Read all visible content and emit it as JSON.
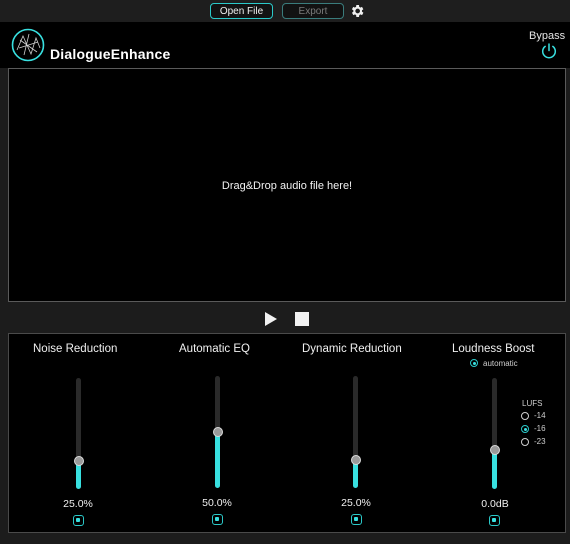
{
  "toolbar": {
    "open_file_label": "Open File",
    "export_label": "Export"
  },
  "header": {
    "title": "DialogueEnhance",
    "bypass_label": "Bypass"
  },
  "dropzone": {
    "text": "Drag&Drop audio file here!"
  },
  "modules": [
    {
      "label": "Noise Reduction",
      "value_text": "25.0%",
      "level": 0.25,
      "enabled": true
    },
    {
      "label": "Automatic EQ",
      "value_text": "50.0%",
      "level": 0.5,
      "enabled": true
    },
    {
      "label": "Dynamic Reduction",
      "value_text": "25.0%",
      "level": 0.25,
      "enabled": true
    },
    {
      "label": "Loudness Boost",
      "value_text": "0.0dB",
      "level": 0.35,
      "enabled": true,
      "automatic_label": "automatic",
      "lufs": {
        "label": "LUFS",
        "options": [
          "-14",
          "-16",
          "-23"
        ],
        "selected": "-16"
      }
    }
  ],
  "colors": {
    "accent": "#38e0e0",
    "background": "#000000",
    "chrome": "#1c1c1c"
  }
}
